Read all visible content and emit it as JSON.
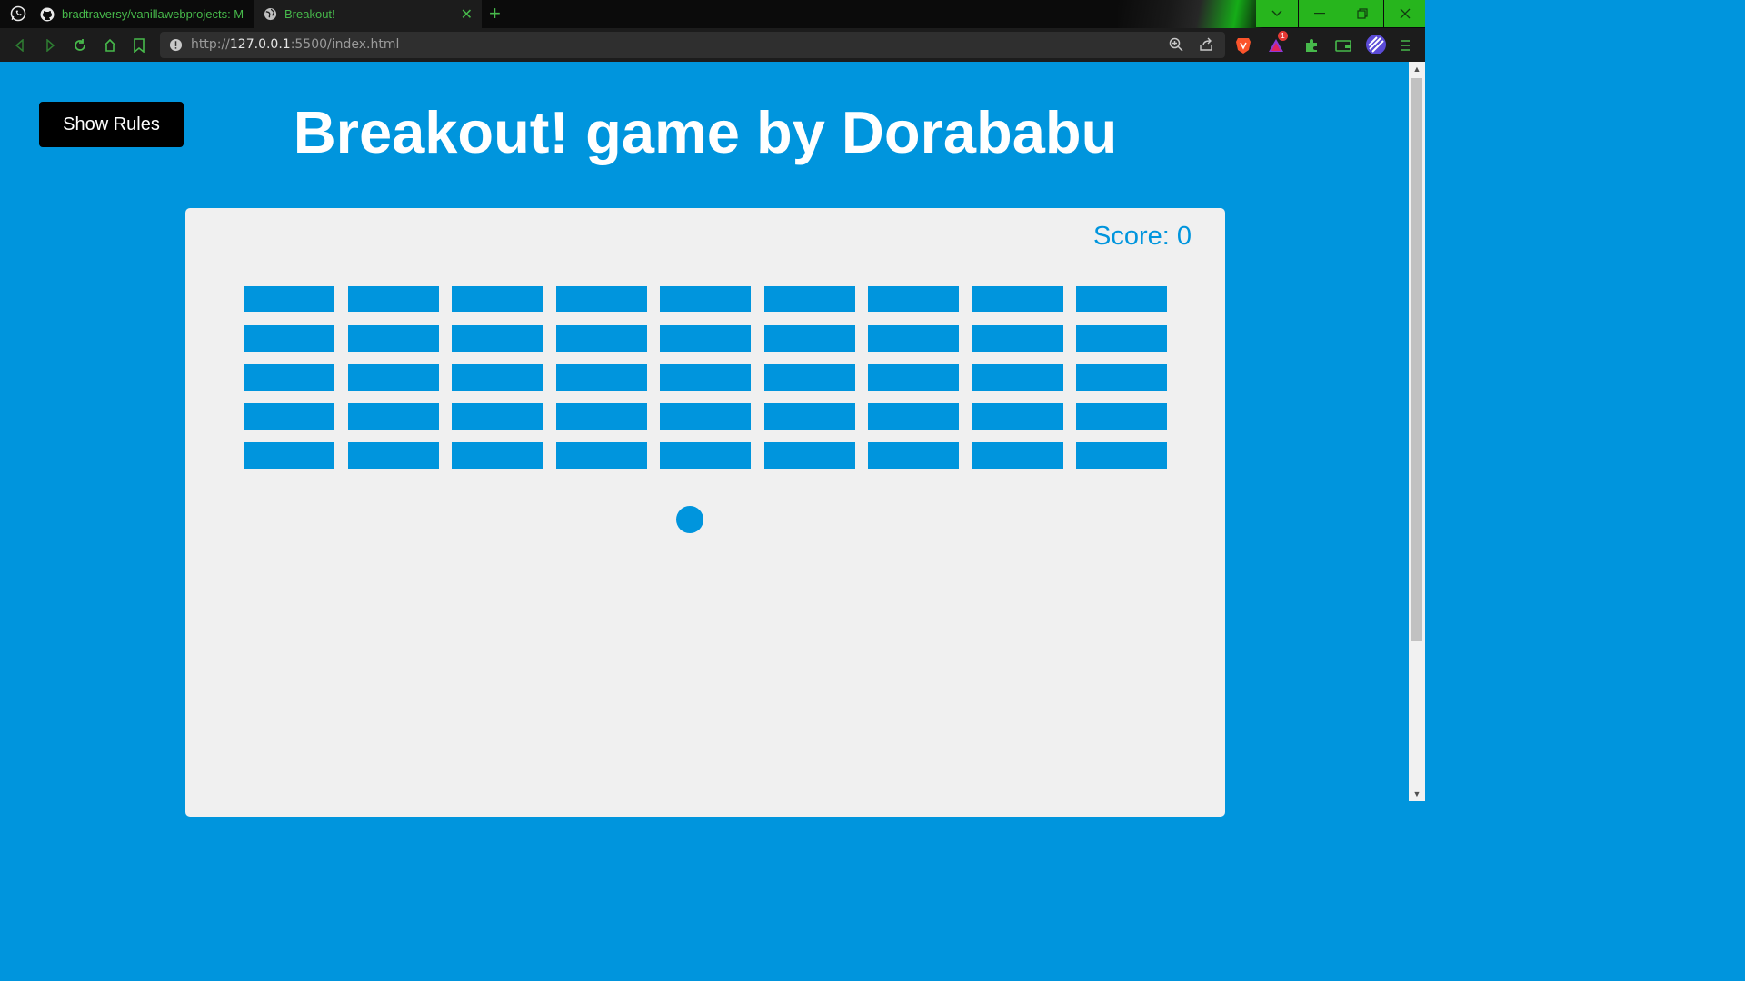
{
  "browser": {
    "tabs": [
      {
        "label": "bradtraversy/vanillawebprojects: Mini",
        "icon": "github-icon",
        "active": false
      },
      {
        "label": "Breakout!",
        "icon": "globe-icon",
        "active": true
      }
    ],
    "url_prefix": "http://",
    "url_host": "127.0.0.1",
    "url_rest": ":5500/index.html",
    "brave_badge": "1"
  },
  "page": {
    "show_rules_label": "Show Rules",
    "title": "Breakout! game by Dorababu",
    "score_label": "Score: 0",
    "colors": {
      "background": "#0095dd",
      "canvas": "#f0f0f0",
      "accent": "#0095dd"
    },
    "bricks": {
      "rows": 5,
      "columns": 9
    }
  }
}
